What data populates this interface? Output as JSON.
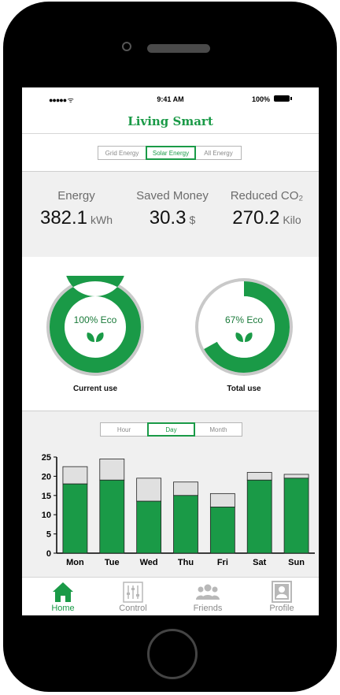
{
  "status_bar": {
    "signal": "●●●●● ᯤ",
    "time": "9:41 AM",
    "battery": "100%"
  },
  "app": {
    "title": "Living Smart"
  },
  "energy_tabs": {
    "items": [
      {
        "label": "Grid Energy",
        "active": false
      },
      {
        "label": "Solar Energy",
        "active": true
      },
      {
        "label": "All Energy",
        "active": false
      }
    ]
  },
  "stats": [
    {
      "label": "Energy",
      "value": "382.1",
      "unit": "kWh"
    },
    {
      "label": "Saved Money",
      "value": "30.3",
      "unit": "$"
    },
    {
      "label": "Reduced CO₂",
      "value": "270.2",
      "unit": "Kilo"
    }
  ],
  "gauges": [
    {
      "eco_text": "100% Eco",
      "label": "Current use",
      "percent": 100
    },
    {
      "eco_text": "67% Eco",
      "label": "Total use",
      "percent": 67
    }
  ],
  "time_tabs": {
    "items": [
      {
        "label": "Hour",
        "active": false
      },
      {
        "label": "Day",
        "active": true
      },
      {
        "label": "Month",
        "active": false
      }
    ]
  },
  "colors": {
    "accent": "#1a9a47",
    "bar_grey": "#e0e0e0",
    "ring_grey": "#c9c9c9"
  },
  "chart_data": {
    "type": "bar",
    "categories": [
      "Mon",
      "Tue",
      "Wed",
      "Thu",
      "Fri",
      "Sat",
      "Sun"
    ],
    "series": [
      {
        "values": [
          18,
          19,
          13.5,
          15,
          12,
          19,
          19.5
        ]
      },
      {
        "values": [
          4.5,
          5.5,
          6,
          3.5,
          3.5,
          2,
          1
        ]
      }
    ],
    "stacked": true,
    "yticks": [
      "0",
      "5",
      "10",
      "15",
      "20",
      "25"
    ],
    "ylim": [
      0,
      25
    ]
  },
  "tabbar": {
    "items": [
      {
        "label": "Home",
        "icon": "home-icon",
        "active": true
      },
      {
        "label": "Control",
        "icon": "control-icon",
        "active": false
      },
      {
        "label": "Friends",
        "icon": "friends-icon",
        "active": false
      },
      {
        "label": "Profile",
        "icon": "profile-icon",
        "active": false
      }
    ]
  }
}
